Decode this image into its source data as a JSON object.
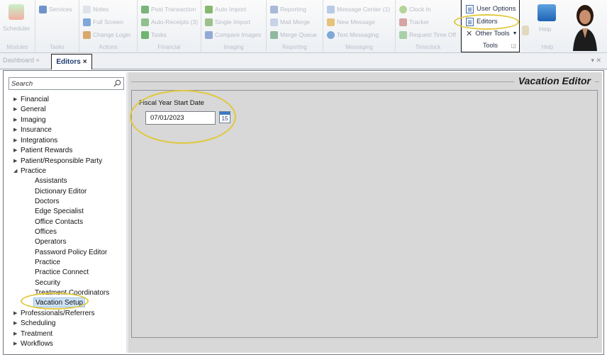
{
  "ribbon": {
    "groups": [
      {
        "label": "Modules",
        "items": [
          "Scheduler"
        ]
      },
      {
        "label": "Tasks",
        "items": [
          "Services",
          "Notes"
        ]
      },
      {
        "label": "Actions",
        "items": [
          "Full Screen",
          "Change Login"
        ]
      },
      {
        "label": "Financial",
        "items": [
          "Post Transaction",
          "Auto-Receipts (3)",
          "Tasks"
        ]
      },
      {
        "label": "Imaging",
        "items": [
          "Auto Import",
          "Single Import",
          "Compare Images"
        ]
      },
      {
        "label": "Reporting",
        "items": [
          "Reporting",
          "Mail Merge",
          "Merge Queue"
        ]
      },
      {
        "label": "Messaging",
        "items": [
          "Message Center (1)",
          "New Message",
          "Text Messaging"
        ]
      },
      {
        "label": "Timeclock",
        "items": [
          "Clock In",
          "Tracker",
          "Request Time Off"
        ]
      },
      {
        "label": "Help",
        "items": [
          "Help"
        ]
      }
    ],
    "tools": {
      "label": "Tools",
      "items": [
        "User Options",
        "Editors",
        "Other Tools"
      ]
    }
  },
  "tabs": {
    "dashboard": "Dashboard",
    "editors": "Editors",
    "close_glyph": "×"
  },
  "sidebar": {
    "search_placeholder": "Search",
    "items": [
      "Financial",
      "General",
      "Imaging",
      "Insurance",
      "Integrations",
      "Patient Rewards",
      "Patient/Responsible Party",
      "Practice"
    ],
    "practice_children": [
      "Assistants",
      "Dictionary Editor",
      "Doctors",
      "Edge Specialist",
      "Office Contacts",
      "Offices",
      "Operators",
      "Password Policy Editor",
      "Practice",
      "Practice Connect",
      "Security",
      "Treatment Coordinators",
      "Vacation Setup"
    ],
    "items_after": [
      "Professionals/Referrers",
      "Scheduling",
      "Treatment",
      "Workflows"
    ]
  },
  "editor": {
    "title": "Vacation Editor",
    "field_label": "Fiscal Year Start Date",
    "field_value": "07/01/2023",
    "calendar_day": "15"
  },
  "colors": {
    "highlight": "#e0c83c",
    "selection": "#cfe3f7",
    "panel": "#d8d8d8"
  }
}
